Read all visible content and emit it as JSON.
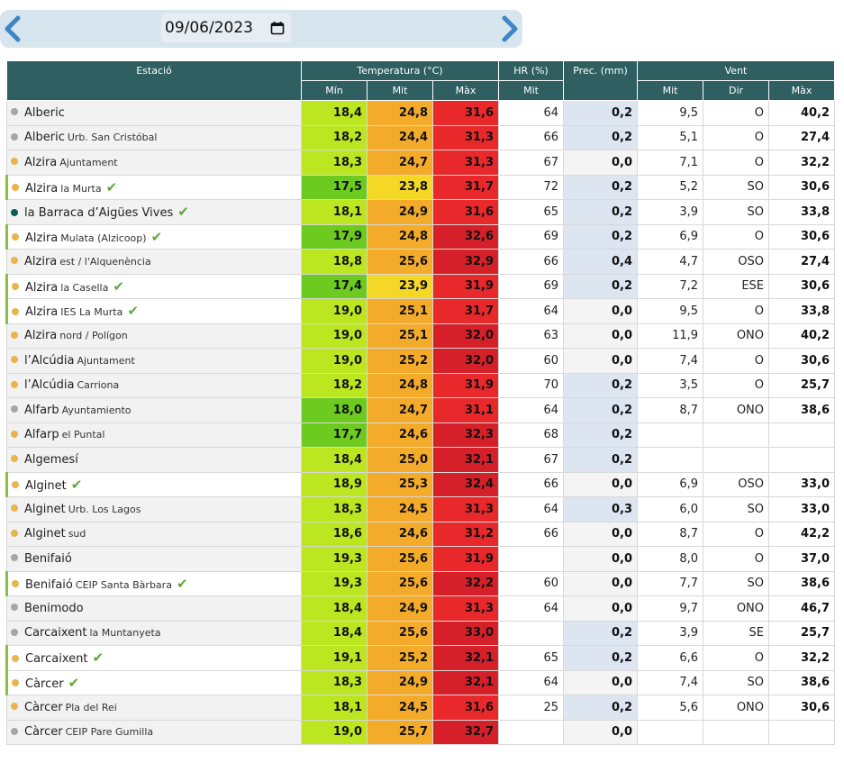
{
  "date": {
    "value": "09/06/2023"
  },
  "header": {
    "station": "Estació",
    "temperature": "Temperatura (°C)",
    "humidity": "HR (%)",
    "precipitation": "Prec. (mm)",
    "wind": "Vent",
    "sub": {
      "t_min": "Mín",
      "t_mit": "Mit",
      "t_max": "Màx",
      "hr_mit": "Mit",
      "w_mit": "Mit",
      "w_dir": "Dir",
      "w_max": "Màx"
    }
  },
  "colors": {
    "dot_gray": "#a6a6a6",
    "dot_yellow": "#e8b44c",
    "dot_teal": "#0e5a56",
    "marked_border": "#8cbf3f",
    "check": "#5ea83a"
  },
  "rows": [
    {
      "name": "Alberic",
      "sub": "",
      "dot": "gray",
      "marked": false,
      "check": false,
      "tmin": "18,4",
      "tmit": "24,8",
      "tmax": "31,6",
      "hr": "64",
      "prec": "0,2",
      "prec_bg": true,
      "wmit": "9,5",
      "wdir": "O",
      "wmax": "40,2",
      "c1": "#bce61f",
      "c2": "#f5ab2a",
      "c3": "#e8282a"
    },
    {
      "name": "Alberic",
      "sub": "Urb. San Cristóbal",
      "dot": "gray",
      "marked": false,
      "check": false,
      "tmin": "18,2",
      "tmit": "24,4",
      "tmax": "31,3",
      "hr": "66",
      "prec": "0,2",
      "prec_bg": true,
      "wmit": "5,1",
      "wdir": "O",
      "wmax": "27,4",
      "c1": "#bce61f",
      "c2": "#f5ab2a",
      "c3": "#e8282a"
    },
    {
      "name": "Alzira",
      "sub": "Ajuntament",
      "dot": "yellow",
      "marked": false,
      "check": false,
      "tmin": "18,3",
      "tmit": "24,7",
      "tmax": "31,3",
      "hr": "67",
      "prec": "0,0",
      "prec_bg": false,
      "wmit": "7,1",
      "wdir": "O",
      "wmax": "32,2",
      "c1": "#bce61f",
      "c2": "#f5ab2a",
      "c3": "#e8282a"
    },
    {
      "name": "Alzira",
      "sub": "la Murta",
      "dot": "yellow",
      "marked": true,
      "check": true,
      "tmin": "17,5",
      "tmit": "23,8",
      "tmax": "31,7",
      "hr": "72",
      "prec": "0,2",
      "prec_bg": true,
      "wmit": "5,2",
      "wdir": "SO",
      "wmax": "30,6",
      "c1": "#6ccb1e",
      "c2": "#f5d726",
      "c3": "#e8282a"
    },
    {
      "name": "la Barraca d’Aigües Vives",
      "sub": "",
      "dot": "teal",
      "marked": false,
      "check": true,
      "tmin": "18,1",
      "tmit": "24,9",
      "tmax": "31,6",
      "hr": "65",
      "prec": "0,2",
      "prec_bg": true,
      "wmit": "3,9",
      "wdir": "SO",
      "wmax": "33,8",
      "c1": "#bce61f",
      "c2": "#f5ab2a",
      "c3": "#e8282a"
    },
    {
      "name": "Alzira",
      "sub": "Mulata (Alzicoop)",
      "dot": "yellow",
      "marked": true,
      "check": true,
      "tmin": "17,9",
      "tmit": "24,8",
      "tmax": "32,6",
      "hr": "69",
      "prec": "0,2",
      "prec_bg": true,
      "wmit": "6,9",
      "wdir": "O",
      "wmax": "30,6",
      "c1": "#6ccb1e",
      "c2": "#f5ab2a",
      "c3": "#d5202a"
    },
    {
      "name": "Alzira",
      "sub": "est / l'Alquenència",
      "dot": "yellow",
      "marked": false,
      "check": false,
      "tmin": "18,8",
      "tmit": "25,6",
      "tmax": "32,9",
      "hr": "66",
      "prec": "0,4",
      "prec_bg": true,
      "wmit": "4,7",
      "wdir": "OSO",
      "wmax": "27,4",
      "c1": "#bce61f",
      "c2": "#f5ab2a",
      "c3": "#d5202a"
    },
    {
      "name": "Alzira",
      "sub": "la Casella",
      "dot": "yellow",
      "marked": true,
      "check": true,
      "tmin": "17,4",
      "tmit": "23,9",
      "tmax": "31,9",
      "hr": "69",
      "prec": "0,2",
      "prec_bg": true,
      "wmit": "7,2",
      "wdir": "ESE",
      "wmax": "30,6",
      "c1": "#6ccb1e",
      "c2": "#f5d726",
      "c3": "#e8282a"
    },
    {
      "name": "Alzira",
      "sub": "IES La Murta",
      "dot": "yellow",
      "marked": true,
      "check": true,
      "tmin": "19,0",
      "tmit": "25,1",
      "tmax": "31,7",
      "hr": "64",
      "prec": "0,0",
      "prec_bg": false,
      "wmit": "9,5",
      "wdir": "O",
      "wmax": "33,8",
      "c1": "#bce61f",
      "c2": "#f5ab2a",
      "c3": "#e8282a"
    },
    {
      "name": "Alzira",
      "sub": "nord / Polígon",
      "dot": "yellow",
      "marked": false,
      "check": false,
      "tmin": "19,0",
      "tmit": "25,1",
      "tmax": "32,0",
      "hr": "63",
      "prec": "0,0",
      "prec_bg": false,
      "wmit": "11,9",
      "wdir": "ONO",
      "wmax": "40,2",
      "c1": "#bce61f",
      "c2": "#f5ab2a",
      "c3": "#d5202a"
    },
    {
      "name": "l’Alcúdia",
      "sub": "Ajuntament",
      "dot": "yellow",
      "marked": false,
      "check": false,
      "tmin": "19,0",
      "tmit": "25,2",
      "tmax": "32,0",
      "hr": "60",
      "prec": "0,0",
      "prec_bg": false,
      "wmit": "7,4",
      "wdir": "O",
      "wmax": "30,6",
      "c1": "#bce61f",
      "c2": "#f5ab2a",
      "c3": "#d5202a"
    },
    {
      "name": "l’Alcúdia",
      "sub": "Carriona",
      "dot": "yellow",
      "marked": false,
      "check": false,
      "tmin": "18,2",
      "tmit": "24,8",
      "tmax": "31,9",
      "hr": "70",
      "prec": "0,2",
      "prec_bg": true,
      "wmit": "3,5",
      "wdir": "O",
      "wmax": "25,7",
      "c1": "#bce61f",
      "c2": "#f5ab2a",
      "c3": "#e8282a"
    },
    {
      "name": "Alfarb",
      "sub": "Ayuntamiento",
      "dot": "gray",
      "marked": false,
      "check": false,
      "tmin": "18,0",
      "tmit": "24,7",
      "tmax": "31,1",
      "hr": "64",
      "prec": "0,2",
      "prec_bg": true,
      "wmit": "8,7",
      "wdir": "ONO",
      "wmax": "38,6",
      "c1": "#6ccb1e",
      "c2": "#f5ab2a",
      "c3": "#e8282a"
    },
    {
      "name": "Alfarp",
      "sub": "el Puntal",
      "dot": "yellow",
      "marked": false,
      "check": false,
      "tmin": "17,7",
      "tmit": "24,6",
      "tmax": "32,3",
      "hr": "68",
      "prec": "0,2",
      "prec_bg": true,
      "wmit": "",
      "wdir": "",
      "wmax": "",
      "c1": "#6ccb1e",
      "c2": "#f5ab2a",
      "c3": "#d5202a"
    },
    {
      "name": "Algemesí",
      "sub": "",
      "dot": "yellow",
      "marked": false,
      "check": false,
      "tmin": "18,4",
      "tmit": "25,0",
      "tmax": "32,1",
      "hr": "67",
      "prec": "0,2",
      "prec_bg": true,
      "wmit": "",
      "wdir": "",
      "wmax": "",
      "c1": "#bce61f",
      "c2": "#f5ab2a",
      "c3": "#d5202a"
    },
    {
      "name": "Alginet",
      "sub": "",
      "dot": "yellow",
      "marked": true,
      "check": true,
      "tmin": "18,9",
      "tmit": "25,3",
      "tmax": "32,4",
      "hr": "66",
      "prec": "0,0",
      "prec_bg": false,
      "wmit": "6,9",
      "wdir": "OSO",
      "wmax": "33,0",
      "c1": "#bce61f",
      "c2": "#f5ab2a",
      "c3": "#d5202a"
    },
    {
      "name": "Alginet",
      "sub": "Urb. Los Lagos",
      "dot": "yellow",
      "marked": false,
      "check": false,
      "tmin": "18,3",
      "tmit": "24,5",
      "tmax": "31,3",
      "hr": "64",
      "prec": "0,3",
      "prec_bg": true,
      "wmit": "6,0",
      "wdir": "SO",
      "wmax": "33,0",
      "c1": "#bce61f",
      "c2": "#f5ab2a",
      "c3": "#e8282a"
    },
    {
      "name": "Alginet",
      "sub": "sud",
      "dot": "yellow",
      "marked": false,
      "check": false,
      "tmin": "18,6",
      "tmit": "24,6",
      "tmax": "31,2",
      "hr": "66",
      "prec": "0,0",
      "prec_bg": false,
      "wmit": "8,7",
      "wdir": "O",
      "wmax": "42,2",
      "c1": "#bce61f",
      "c2": "#f5ab2a",
      "c3": "#e8282a"
    },
    {
      "name": "Benifaió",
      "sub": "",
      "dot": "gray",
      "marked": false,
      "check": false,
      "tmin": "19,3",
      "tmit": "25,6",
      "tmax": "31,9",
      "hr": "",
      "prec": "0,0",
      "prec_bg": false,
      "wmit": "8,0",
      "wdir": "O",
      "wmax": "37,0",
      "c1": "#bce61f",
      "c2": "#f5ab2a",
      "c3": "#e8282a"
    },
    {
      "name": "Benifaió",
      "sub": "CEIP Santa Bàrbara",
      "dot": "yellow",
      "marked": true,
      "check": true,
      "tmin": "19,3",
      "tmit": "25,6",
      "tmax": "32,2",
      "hr": "60",
      "prec": "0,0",
      "prec_bg": false,
      "wmit": "7,7",
      "wdir": "SO",
      "wmax": "38,6",
      "c1": "#bce61f",
      "c2": "#f5ab2a",
      "c3": "#d5202a"
    },
    {
      "name": "Benimodo",
      "sub": "",
      "dot": "gray",
      "marked": false,
      "check": false,
      "tmin": "18,4",
      "tmit": "24,9",
      "tmax": "31,3",
      "hr": "64",
      "prec": "0,0",
      "prec_bg": false,
      "wmit": "9,7",
      "wdir": "ONO",
      "wmax": "46,7",
      "c1": "#bce61f",
      "c2": "#f5ab2a",
      "c3": "#e8282a"
    },
    {
      "name": "Carcaixent",
      "sub": "la Muntanyeta",
      "dot": "gray",
      "marked": false,
      "check": false,
      "tmin": "18,4",
      "tmit": "25,6",
      "tmax": "33,0",
      "hr": "",
      "prec": "0,2",
      "prec_bg": true,
      "wmit": "3,9",
      "wdir": "SE",
      "wmax": "25,7",
      "c1": "#bce61f",
      "c2": "#f5ab2a",
      "c3": "#d5202a"
    },
    {
      "name": "Carcaixent",
      "sub": "",
      "dot": "yellow",
      "marked": true,
      "check": true,
      "tmin": "19,1",
      "tmit": "25,2",
      "tmax": "32,1",
      "hr": "65",
      "prec": "0,2",
      "prec_bg": true,
      "wmit": "6,6",
      "wdir": "O",
      "wmax": "32,2",
      "c1": "#bce61f",
      "c2": "#f5ab2a",
      "c3": "#d5202a"
    },
    {
      "name": "Càrcer",
      "sub": "",
      "dot": "yellow",
      "marked": true,
      "check": true,
      "tmin": "18,3",
      "tmit": "24,9",
      "tmax": "32,1",
      "hr": "64",
      "prec": "0,0",
      "prec_bg": false,
      "wmit": "7,4",
      "wdir": "SO",
      "wmax": "38,6",
      "c1": "#bce61f",
      "c2": "#f5ab2a",
      "c3": "#d5202a"
    },
    {
      "name": "Càrcer",
      "sub": "Pla del Rei",
      "dot": "yellow",
      "marked": false,
      "check": false,
      "tmin": "18,1",
      "tmit": "24,5",
      "tmax": "31,6",
      "hr": "25",
      "prec": "0,2",
      "prec_bg": true,
      "wmit": "5,6",
      "wdir": "ONO",
      "wmax": "30,6",
      "c1": "#bce61f",
      "c2": "#f5ab2a",
      "c3": "#e8282a"
    },
    {
      "name": "Càrcer",
      "sub": "CEIP Pare Gumilla",
      "dot": "gray",
      "marked": false,
      "check": false,
      "tmin": "19,0",
      "tmit": "25,7",
      "tmax": "32,7",
      "hr": "",
      "prec": "0,0",
      "prec_bg": false,
      "wmit": "",
      "wdir": "",
      "wmax": "",
      "c1": "#bce61f",
      "c2": "#f5ab2a",
      "c3": "#d5202a"
    }
  ]
}
